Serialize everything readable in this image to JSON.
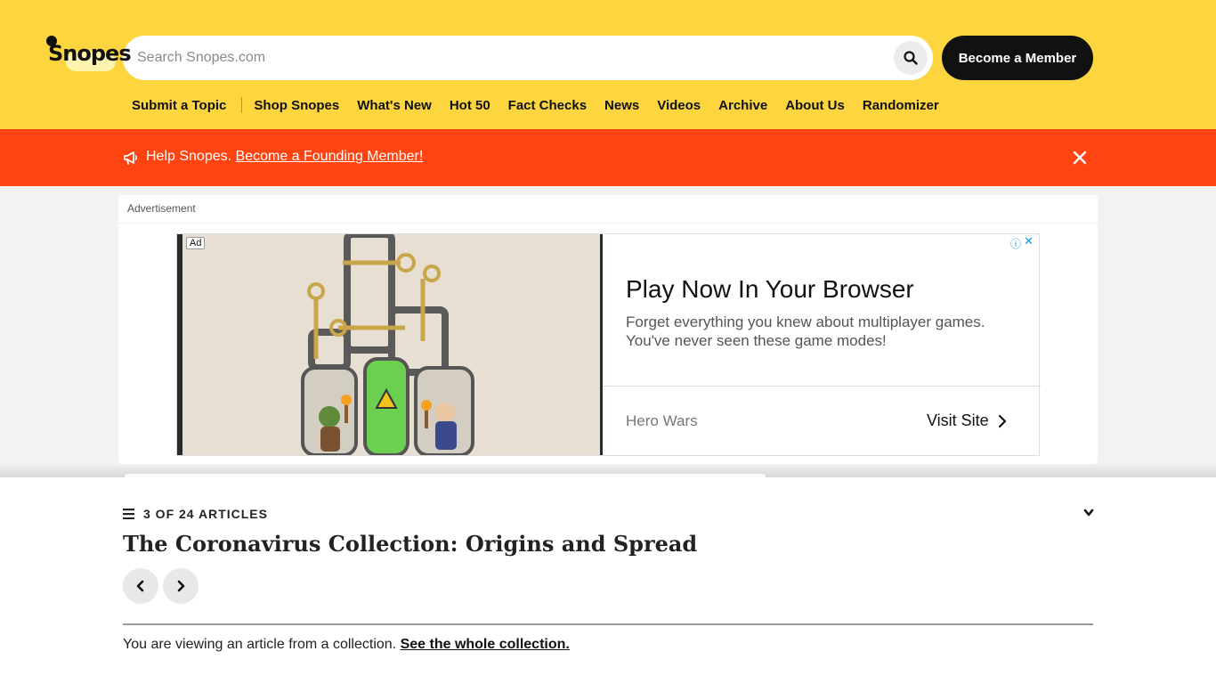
{
  "header": {
    "logo_text": "Snopes",
    "search_placeholder": "Search Snopes.com",
    "member_button": "Become a Member",
    "nav": [
      "Submit a Topic",
      "Shop Snopes",
      "What's New",
      "Hot 50",
      "Fact Checks",
      "News",
      "Videos",
      "Archive",
      "About Us",
      "Randomizer"
    ]
  },
  "banner": {
    "prefix": "Help Snopes. ",
    "link": "Become a Founding Member!",
    "color": "#ff4411"
  },
  "ad": {
    "label": "Advertisement",
    "tag": "Ad",
    "info_icon": "ⓘ",
    "close_icon": "✕",
    "headline": "Play Now In Your Browser",
    "body": "Forget everything you knew about multiplayer games. You've never seen these game modes!",
    "advertiser": "Hero Wars",
    "cta": "Visit Site",
    "cta_chevron": "›"
  },
  "collection": {
    "count": "3 OF 24 ARTICLES",
    "title": "The Coronavirus Collection: Origins and Spread",
    "note_prefix": "You are viewing an article from a collection. ",
    "note_link": "See the whole collection."
  },
  "colors": {
    "header_bg": "#fcd53f",
    "banner_bg": "#ff4411",
    "button_dark": "#111111"
  }
}
